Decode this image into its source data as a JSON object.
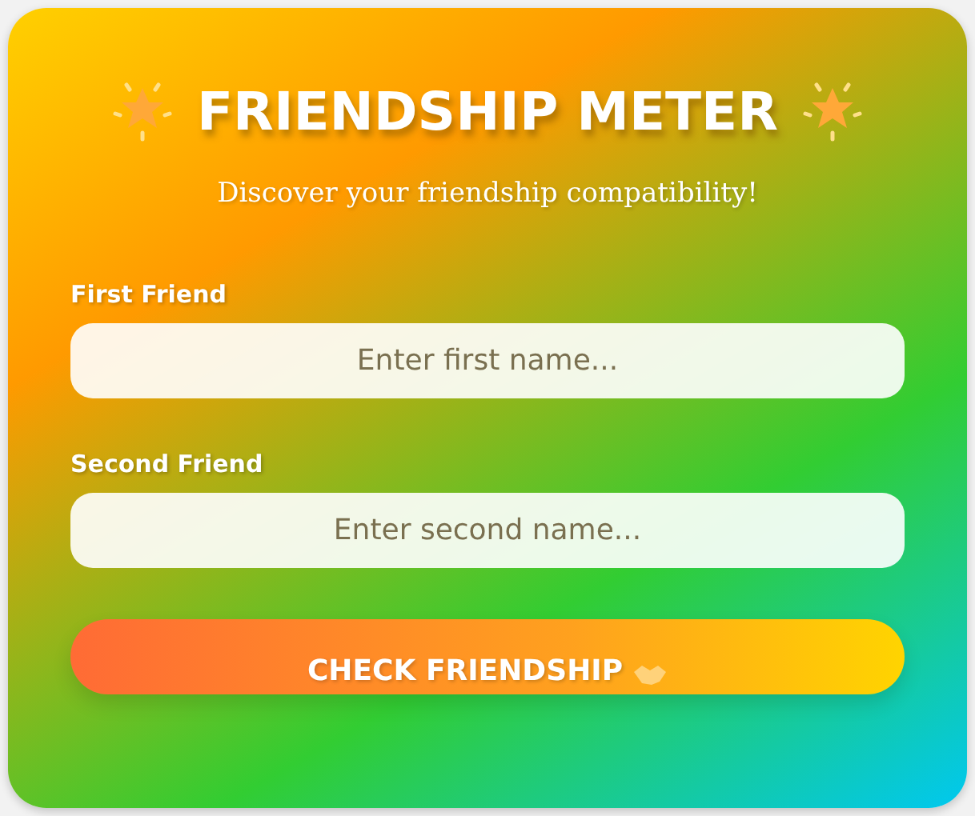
{
  "title": "FRIENDSHIP METER",
  "subtitle": "Discover your friendship compatibility!",
  "fields": [
    {
      "label": "First Friend",
      "placeholder": "Enter first name..."
    },
    {
      "label": "Second Friend",
      "placeholder": "Enter second name..."
    }
  ],
  "button": {
    "label": "CHECK FRIENDSHIP"
  }
}
